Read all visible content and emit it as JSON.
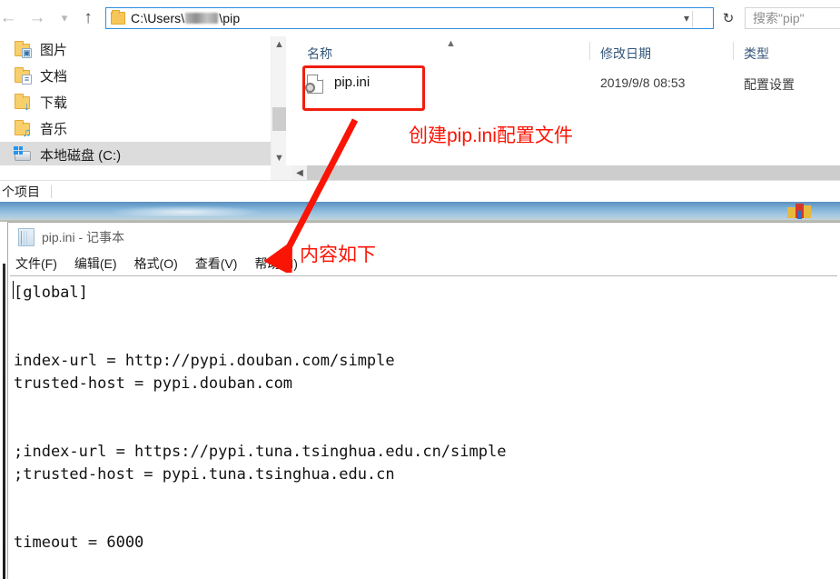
{
  "explorer": {
    "nav": {
      "back_icon": "arrow-left",
      "forward_icon": "arrow-right",
      "recent_icon": "chevron-down",
      "up_icon": "arrow-up",
      "refresh_icon": "refresh"
    },
    "address": {
      "prefix": "C:\\Users\\",
      "suffix": "\\pip",
      "redacted": true,
      "dropdown_icon": "chevron-down"
    },
    "search": {
      "placeholder": "搜索\"pip\""
    },
    "sidebar": {
      "items": [
        {
          "label": "图片",
          "icon": "pictures-folder-icon",
          "selected": false
        },
        {
          "label": "文档",
          "icon": "documents-folder-icon",
          "selected": false
        },
        {
          "label": "下载",
          "icon": "downloads-folder-icon",
          "selected": false
        },
        {
          "label": "音乐",
          "icon": "music-folder-icon",
          "selected": false
        },
        {
          "label": "本地磁盘 (C:)",
          "icon": "local-disk-icon",
          "selected": true
        }
      ]
    },
    "columns": [
      {
        "key": "name",
        "label": "名称"
      },
      {
        "key": "date",
        "label": "修改日期"
      },
      {
        "key": "type",
        "label": "类型"
      }
    ],
    "sort": {
      "column": "名称",
      "direction": "asc",
      "icon": "caret-up-icon"
    },
    "rows": [
      {
        "name": "pip.ini",
        "date": "2019/9/8 08:53",
        "type": "配置设置",
        "icon": "config-file-icon",
        "highlighted": true
      }
    ],
    "status": {
      "count_text": "个项目"
    }
  },
  "notepad": {
    "title": "pip.ini - 记事本",
    "icon": "notepad-icon",
    "menu": [
      "文件(F)",
      "编辑(E)",
      "格式(O)",
      "查看(V)",
      "帮助(H)"
    ],
    "content": "[global]\n\n\nindex-url = http://pypi.douban.com/simple\ntrusted-host = pypi.douban.com\n\n\n;index-url = https://pypi.tuna.tsinghua.edu.cn/simple\n;trusted-host = pypi.tuna.tsinghua.edu.cn\n\n\ntimeout = 6000"
  },
  "annotations": {
    "color": "#fa1405",
    "note_file": "创建pip.ini配置文件",
    "note_content": "内容如下",
    "box_target": "pip.ini",
    "arrow_icon": "red-arrow-icon"
  }
}
